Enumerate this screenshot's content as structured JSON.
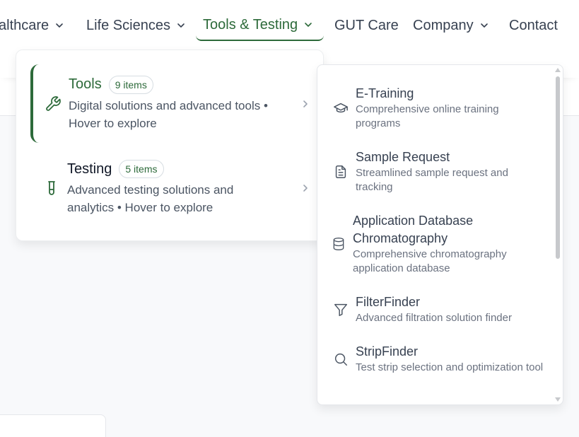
{
  "nav": {
    "items": [
      {
        "label": "althcare"
      },
      {
        "label": "Life Sciences"
      },
      {
        "label": "Tools & Testing"
      },
      {
        "label": "GUT Care"
      },
      {
        "label": "Company"
      },
      {
        "label": "Contact"
      }
    ]
  },
  "menu": {
    "categories": [
      {
        "title": "Tools",
        "badge": "9 items",
        "desc": "Digital solutions and advanced tools • Hover to explore",
        "icon": "wrench-icon"
      },
      {
        "title": "Testing",
        "badge": "5 items",
        "desc": "Advanced testing solutions and analytics • Hover to explore",
        "icon": "test-tube-icon"
      }
    ]
  },
  "submenu": {
    "items": [
      {
        "title": "E-Training",
        "desc": "Comprehensive online training programs",
        "icon": "graduation-cap-icon"
      },
      {
        "title": "Sample Request",
        "desc": "Streamlined sample request and tracking",
        "icon": "document-icon"
      },
      {
        "title": "Application Database Chromatography",
        "desc": "Comprehensive chromatography application database",
        "icon": "database-icon"
      },
      {
        "title": "FilterFinder",
        "desc": "Advanced filtration solution finder",
        "icon": "filter-icon"
      },
      {
        "title": "StripFinder",
        "desc": "Test strip selection and optimization tool",
        "icon": "search-icon"
      }
    ]
  },
  "colors": {
    "accent": "#2d6a3a",
    "text": "#374151",
    "muted": "#6b7280"
  }
}
